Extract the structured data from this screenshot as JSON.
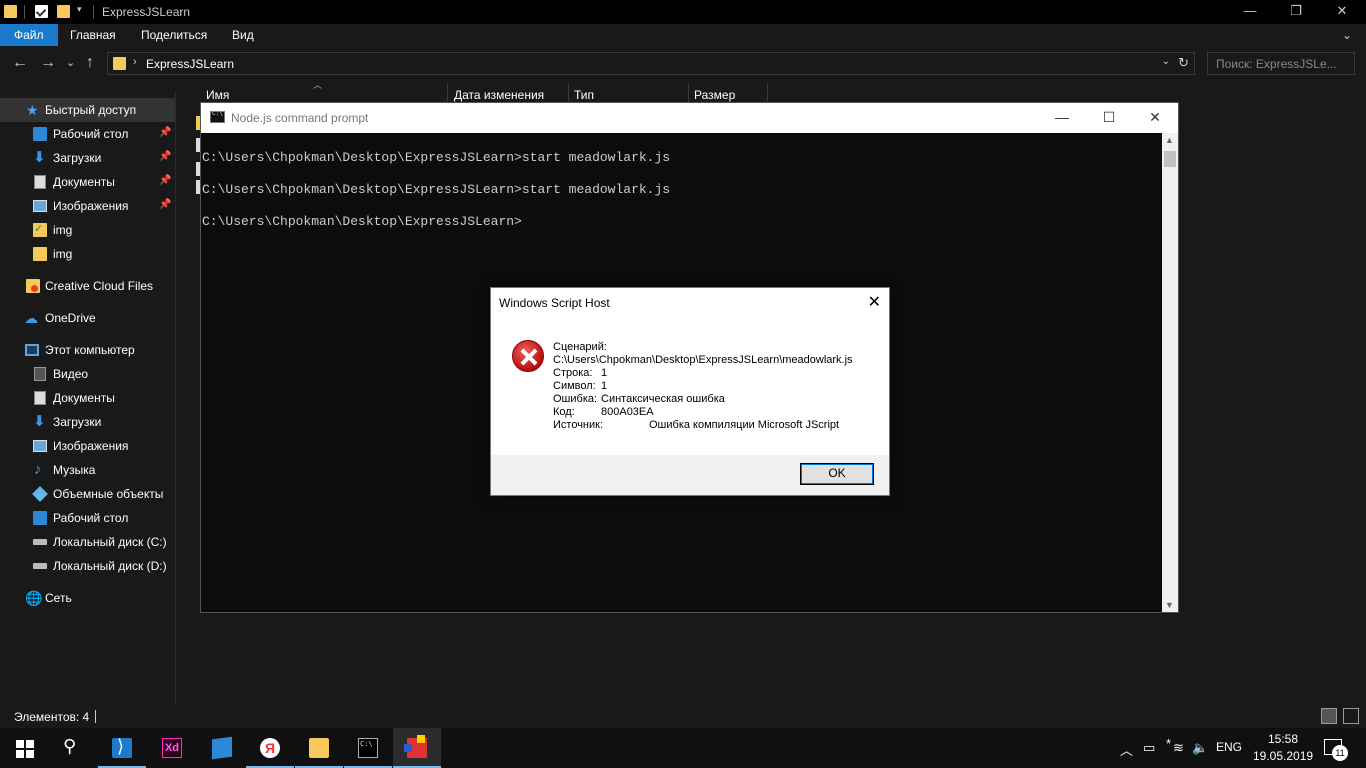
{
  "explorer": {
    "title": "ExpressJSLearn",
    "caption": {
      "minimize": "—",
      "maximize": "❐",
      "close": "✕"
    },
    "ribbon_tabs": [
      "Файл",
      "Главная",
      "Поделиться",
      "Вид"
    ],
    "ribbon_chevron": "⌄",
    "nav": {
      "back": "←",
      "forward": "→",
      "recent": "⌄",
      "up": "↑"
    },
    "address": {
      "separator": "›",
      "path": "ExpressJSLearn",
      "dropdown": "⌄",
      "refresh": "↻"
    },
    "search_placeholder": "Поиск: ExpressJSLe...",
    "columns": [
      "Имя",
      "Дата изменения",
      "Тип",
      "Размер"
    ],
    "sidebar": [
      {
        "label": "Быстрый доступ",
        "icon": "star-icon",
        "selected": true
      },
      {
        "label": "Рабочий стол",
        "icon": "desktop-icon",
        "pinned": true
      },
      {
        "label": "Загрузки",
        "icon": "downloads-icon",
        "pinned": true
      },
      {
        "label": "Документы",
        "icon": "documents-icon",
        "pinned": true
      },
      {
        "label": "Изображения",
        "icon": "pictures-icon",
        "pinned": true
      },
      {
        "label": "img",
        "icon": "synced-folder-icon"
      },
      {
        "label": "img",
        "icon": "folder-icon"
      },
      {
        "label": "Creative Cloud Files",
        "icon": "creative-cloud-folder-icon"
      },
      {
        "label": "OneDrive",
        "icon": "onedrive-cloud-icon"
      },
      {
        "label": "Этот компьютер",
        "icon": "computer-icon"
      },
      {
        "label": "Видео",
        "icon": "video-icon"
      },
      {
        "label": "Документы",
        "icon": "documents-icon"
      },
      {
        "label": "Загрузки",
        "icon": "downloads-icon"
      },
      {
        "label": "Изображения",
        "icon": "pictures-icon"
      },
      {
        "label": "Музыка",
        "icon": "music-icon"
      },
      {
        "label": "Объемные объекты",
        "icon": "3d-objects-icon"
      },
      {
        "label": "Рабочий стол",
        "icon": "desktop-icon"
      },
      {
        "label": "Локальный диск (C:)",
        "icon": "drive-icon"
      },
      {
        "label": "Локальный диск (D:)",
        "icon": "drive-icon"
      },
      {
        "label": "Сеть",
        "icon": "network-icon"
      }
    ],
    "status": "Элементов: 4"
  },
  "console": {
    "title": "Node.js command prompt",
    "lines": [
      "C:\\Users\\Chpokman\\Desktop\\ExpressJSLearn>start meadowlark.js",
      "C:\\Users\\Chpokman\\Desktop\\ExpressJSLearn>start meadowlark.js",
      "C:\\Users\\Chpokman\\Desktop\\ExpressJSLearn>"
    ]
  },
  "dialog": {
    "title": "Windows Script Host",
    "close": "✕",
    "script_label": "Сценарий:",
    "script_path": "C:\\Users\\Chpokman\\Desktop\\ExpressJSLearn\\meadowlark.js",
    "line_label": "Строка:",
    "line_value": "1",
    "char_label": "Символ:",
    "char_value": "1",
    "error_label": "Ошибка:",
    "error_value": "Синтаксическая ошибка",
    "code_label": "Код:",
    "code_value": "800A03EA",
    "source_label": "Источник:",
    "source_value": "Ошибка компиляции Microsoft JScript",
    "ok": "OK"
  },
  "taskbar": {
    "apps": [
      "start-icon",
      "search-icon",
      "vscode-icon",
      "adobe-xd-icon",
      "store-icon",
      "yandex-browser-icon",
      "file-explorer-icon",
      "command-prompt-icon",
      "script-host-icon"
    ],
    "xd_label": "Xd",
    "yandex_label": "Я",
    "cmd_label": "C:\\",
    "tray": {
      "chevron": "︿",
      "battery": "▭",
      "bluetooth": "*",
      "wifi": "≋",
      "volume": "🔈",
      "lang": "ENG"
    },
    "time": "15:58",
    "date": "19.05.2019",
    "notifications": "11"
  },
  "colors": {
    "accent": "#1979ca",
    "error": "#c11414",
    "background": "#191919"
  }
}
